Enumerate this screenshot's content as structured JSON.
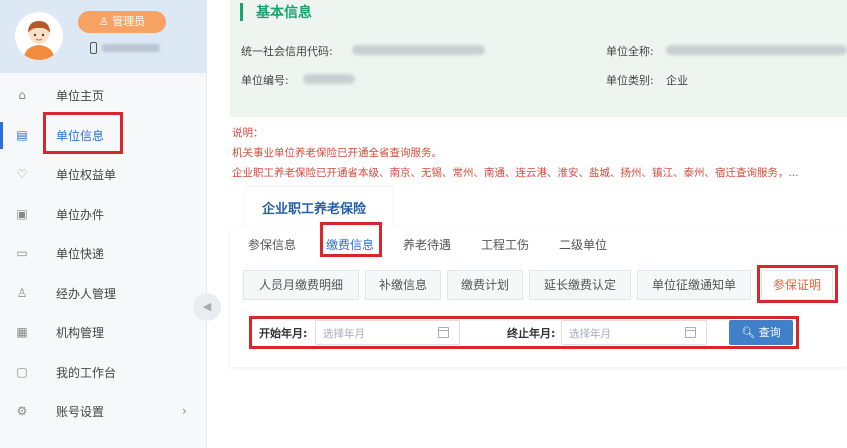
{
  "user": {
    "role_badge": "管理员"
  },
  "sidebar": {
    "items": [
      {
        "label": "单位主页",
        "icon": "home-icon"
      },
      {
        "label": "单位信息",
        "icon": "document-icon",
        "active": true
      },
      {
        "label": "单位权益单",
        "icon": "shield-icon"
      },
      {
        "label": "单位办件",
        "icon": "file-icon"
      },
      {
        "label": "单位快递",
        "icon": "truck-icon"
      },
      {
        "label": "经办人管理",
        "icon": "person-icon"
      },
      {
        "label": "机构管理",
        "icon": "building-icon"
      },
      {
        "label": "我的工作台",
        "icon": "workbench-icon"
      },
      {
        "label": "账号设置",
        "icon": "gear-icon"
      }
    ],
    "collapse_icon": "chevron-left-icon"
  },
  "basic_info": {
    "title": "基本信息",
    "credit_code_label": "统一社会信用代码:",
    "unit_number_label": "单位编号:",
    "unit_fullname_label": "单位全称:",
    "unit_type_label": "单位类别:",
    "unit_type_value": "企业"
  },
  "notes": {
    "heading": "说明：",
    "line1": "机关事业单位养老保险已开通全省查询服务。",
    "line2": "企业职工养老保险已开通省本级、南京、无锡、常州、南通、连云港、淮安、盐城、扬州、镇江、泰州、宿迁查询服务，..."
  },
  "panel": {
    "title": "企业职工养老保险",
    "tabs": [
      "参保信息",
      "缴费信息",
      "养老待遇",
      "工程工伤",
      "二级单位"
    ],
    "buttons": [
      "人员月缴费明细",
      "补缴信息",
      "缴费计划",
      "延长缴费认定",
      "单位征缴通知单",
      "参保证明"
    ]
  },
  "search": {
    "start_label": "开始年月:",
    "start_placeholder": "选择年月",
    "end_label": "终止年月:",
    "end_placeholder": "选择年月",
    "query_label": "查询"
  },
  "colors": {
    "accent_blue": "#2f6fd6",
    "title_green": "#1aa36f",
    "highlight_red": "#d8262d",
    "badge_orange": "#f7a263",
    "note_red": "#d64a3c"
  }
}
